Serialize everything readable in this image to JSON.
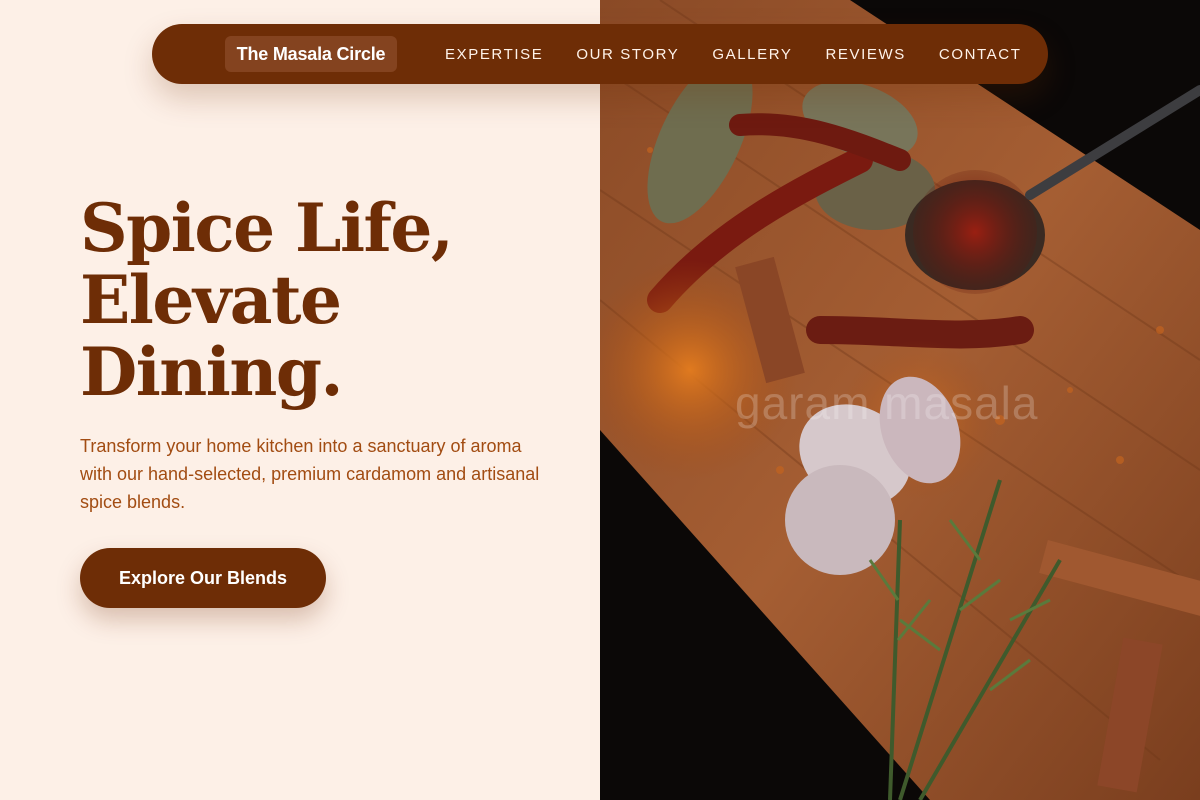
{
  "nav": {
    "brand": "The Masala Circle",
    "links": [
      "EXPERTISE",
      "OUR STORY",
      "GALLERY",
      "REVIEWS",
      "CONTACT"
    ]
  },
  "hero": {
    "headline": [
      "Spice Life,",
      "Elevate",
      "Dining."
    ],
    "subtext": "Transform your home kitchen into a sanctuary of aroma with our hand-selected, premium cardamom and artisanal spice blends.",
    "cta_label": "Explore Our Blends"
  },
  "image": {
    "watermark": "garam masala",
    "icon": "spices-photo"
  },
  "colors": {
    "brand_brown": "#6e2d06",
    "background_cream": "#fdf0e7",
    "body_text": "#a24c12",
    "brand_pill": "#84431f"
  }
}
